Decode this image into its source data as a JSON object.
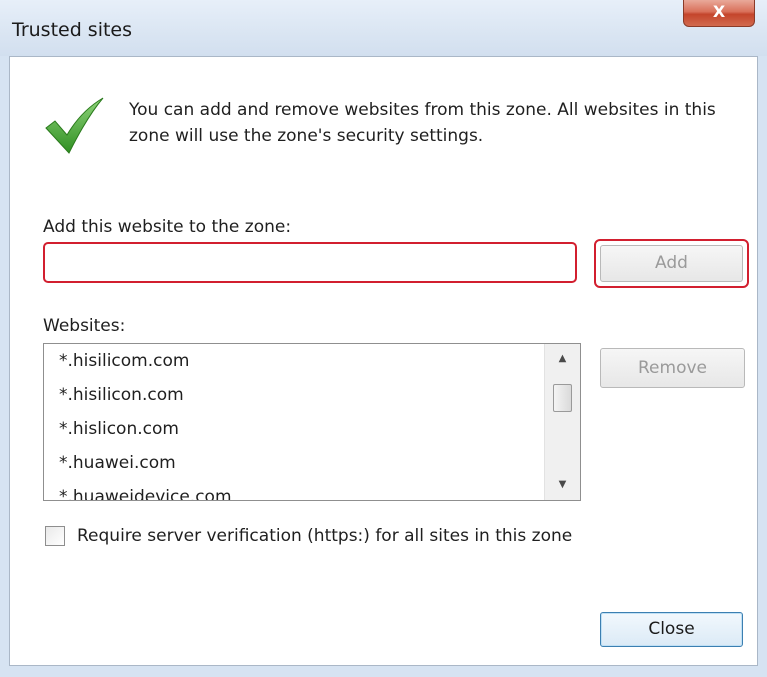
{
  "window": {
    "title": "Trusted sites",
    "close_glyph": "X"
  },
  "intro": {
    "icon": "green-checkmark-icon",
    "text": "You can add and remove websites from this zone. All websites in this zone will use the zone's security settings."
  },
  "add_site": {
    "label": "Add this website to the zone:",
    "input_value": "",
    "add_button_label": "Add"
  },
  "websites": {
    "label": "Websites:",
    "items": [
      "*.hisilicom.com",
      "*.hisilicon.com",
      "*.hislicon.com",
      "*.huawei.com",
      "*.huaweidevice.com"
    ],
    "remove_button_label": "Remove"
  },
  "require_verification": {
    "label": "Require server verification (https:) for all sites in this zone",
    "checked": false
  },
  "footer": {
    "close_button_label": "Close"
  },
  "colors": {
    "highlight_outline": "#d21f2f",
    "checkmark_green": "#3ea12a",
    "titlebar": "#dbe6f3",
    "close_button": "#c4452c"
  }
}
